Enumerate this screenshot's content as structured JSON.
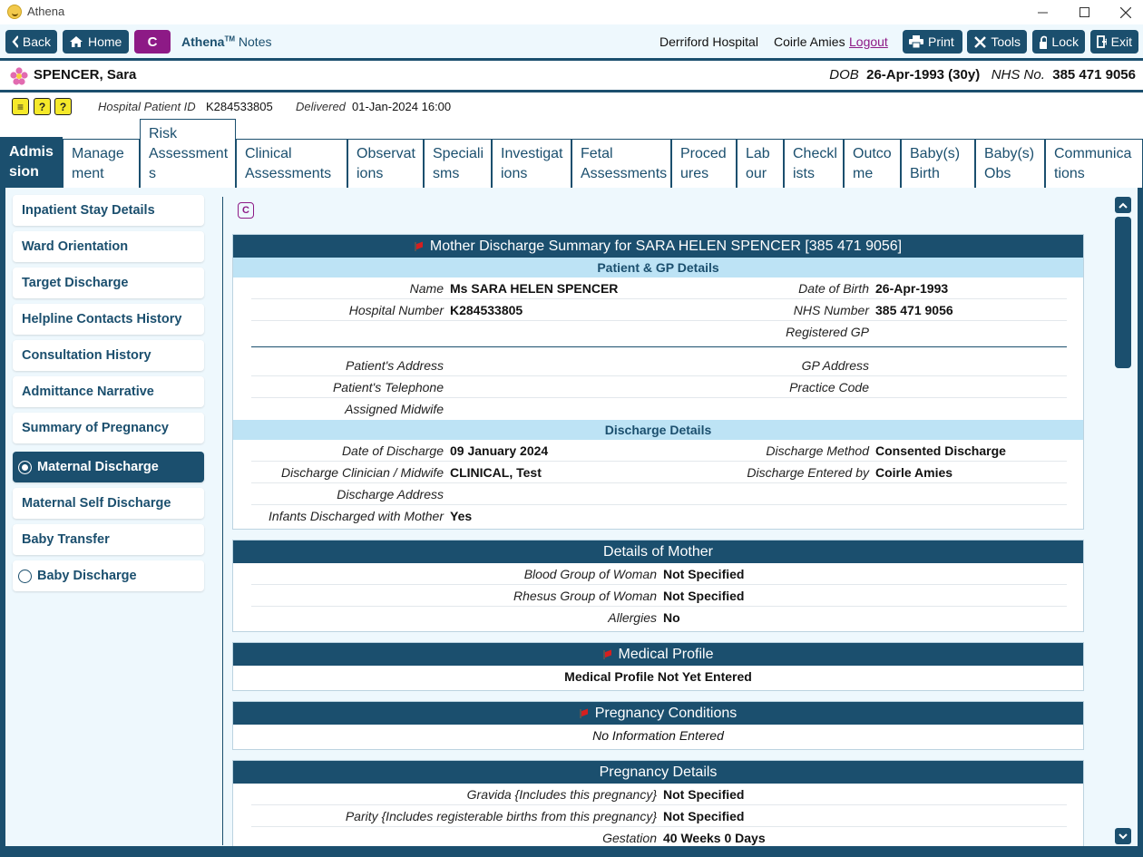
{
  "window": {
    "title": "Athena"
  },
  "toolbar": {
    "back": "Back",
    "home": "Home",
    "c_button": "C",
    "brand_name": "Athena",
    "brand_tm": "TM",
    "brand_suffix": "Notes",
    "hospital": "Derriford Hospital",
    "user": "Coirle Amies",
    "logout": "Logout",
    "print": "Print",
    "tools": "Tools",
    "lock": "Lock",
    "exit": "Exit"
  },
  "patient": {
    "name": "SPENCER, Sara",
    "dob_label": "DOB",
    "dob_value": "26-Apr-1993 (30y)",
    "nhs_label": "NHS No.",
    "nhs_value": "385 471 9056"
  },
  "info": {
    "hospital_id_label": "Hospital Patient ID",
    "hospital_id_value": "K284533805",
    "delivered_label": "Delivered",
    "delivered_value": "01-Jan-2024 16:00"
  },
  "tabs": [
    {
      "line1": "Admis",
      "line2": "sion"
    },
    {
      "line1": "Manage",
      "line2": "ment"
    },
    {
      "line1": "Risk",
      "line2": "Assessment",
      "line3": "s"
    },
    {
      "line1": "Clinical",
      "line2": "Assessments"
    },
    {
      "line1": "Observat",
      "line2": "ions"
    },
    {
      "line1": "Speciali",
      "line2": "sms"
    },
    {
      "line1": "Investigat",
      "line2": "ions"
    },
    {
      "line1": "Fetal",
      "line2": "Assessments"
    },
    {
      "line1": "Proced",
      "line2": "ures"
    },
    {
      "line1": "Lab",
      "line2": "our"
    },
    {
      "line1": "Checkl",
      "line2": "ists"
    },
    {
      "line1": "Outco",
      "line2": "me"
    },
    {
      "line1": "Baby(s)",
      "line2": "Birth"
    },
    {
      "line1": "Baby(s)",
      "line2": "Obs"
    },
    {
      "line1": "Communica",
      "line2": "tions"
    }
  ],
  "sidebar": {
    "items": [
      "Inpatient Stay Details",
      "Ward Orientation",
      "Target Discharge",
      "Helpline Contacts History",
      "Consultation History",
      "Admittance Narrative",
      "Summary of Pregnancy",
      "Maternal Discharge",
      "Maternal Self Discharge",
      "Baby Transfer",
      "Baby Discharge"
    ]
  },
  "content": {
    "c_icon": "C",
    "summary": {
      "title": "Mother Discharge Summary for SARA HELEN SPENCER [385 471 9056]",
      "patient_gp_header": "Patient & GP Details",
      "name_label": "Name",
      "name_value": "Ms SARA HELEN SPENCER",
      "dob_label": "Date of Birth",
      "dob_value": "26-Apr-1993",
      "hospnum_label": "Hospital Number",
      "hospnum_value": "K284533805",
      "nhs_label": "NHS Number",
      "nhs_value": "385 471 9056",
      "gp_label": "Registered GP",
      "address_label": "Patient's Address",
      "gp_address_label": "GP Address",
      "telephone_label": "Patient's Telephone",
      "practice_label": "Practice Code",
      "midwife_label": "Assigned Midwife",
      "discharge_header": "Discharge Details",
      "date_label": "Date of Discharge",
      "date_value": "09 January 2024",
      "method_label": "Discharge Method",
      "method_value": "Consented Discharge",
      "clinician_label": "Discharge Clinician / Midwife",
      "clinician_value": "CLINICAL, Test",
      "entered_label": "Discharge Entered by",
      "entered_value": "Coirle Amies",
      "daddress_label": "Discharge Address",
      "infants_label": "Infants Discharged with Mother",
      "infants_value": "Yes"
    },
    "mother": {
      "title": "Details of Mother",
      "blood_label": "Blood Group of Woman",
      "blood_value": "Not Specified",
      "rhesus_label": "Rhesus Group of Woman",
      "rhesus_value": "Not Specified",
      "allergies_label": "Allergies",
      "allergies_value": "No"
    },
    "medical": {
      "title": "Medical Profile",
      "text": "Medical Profile Not Yet Entered"
    },
    "conditions": {
      "title": "Pregnancy Conditions",
      "text": "No Information Entered"
    },
    "pregnancy": {
      "title": "Pregnancy Details",
      "gravida_label": "Gravida {Includes this pregnancy}",
      "gravida_value": "Not Specified",
      "parity_label": "Parity {Includes registerable births from this pregnancy}",
      "parity_value": "Not Specified",
      "gestation_label": "Gestation",
      "gestation_value": "40 Weeks 0 Days"
    }
  },
  "colors": {
    "primary": "#1b4f6e",
    "accent": "#8d1a86",
    "light": "#eef8fd",
    "subheader": "#bde3f5"
  }
}
